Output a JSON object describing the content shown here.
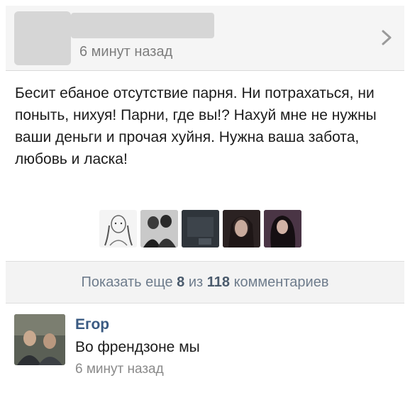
{
  "post": {
    "time": "6 минут назад",
    "text": "Бесит ебаное отсутствие парня. Ни потрахаться, ни поныть, нихуя! Парни, где вы!? Нахуй мне не нужны ваши деньги и прочая хуйня. Нужна ваша забота, любовь и ласка!"
  },
  "likers": [
    {
      "icon": "sketch-girl-avatar"
    },
    {
      "icon": "couple-avatar"
    },
    {
      "icon": "dark-sign-avatar"
    },
    {
      "icon": "girl-portrait-avatar"
    },
    {
      "icon": "girl-dark-hair-avatar"
    }
  ],
  "comments_bar": {
    "prefix": "Показать еще",
    "shown": "8",
    "middle": "из",
    "total": "118",
    "suffix": "комментариев"
  },
  "comment": {
    "author": "Егор",
    "text": "Во френдзоне мы",
    "time": "6 минут назад"
  },
  "colors": {
    "link": "#3a5a82",
    "muted": "#7d7d7d",
    "bar_text": "#6e7c8c"
  }
}
